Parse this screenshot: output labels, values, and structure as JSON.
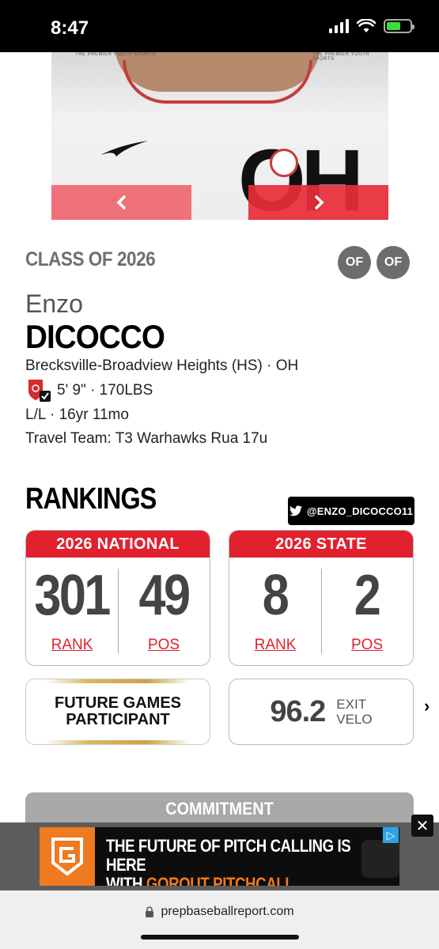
{
  "status_bar": {
    "time": "8:47"
  },
  "photo": {
    "prev_icon": "chevron-left-icon",
    "next_icon": "chevron-right-icon",
    "shirt_tagline": "THE PREMIER YOUTH SPORTS",
    "shirt_text": "OH"
  },
  "player": {
    "class_year": "CLASS OF 2026",
    "positions": [
      "OF",
      "OF"
    ],
    "first_name": "Enzo",
    "last_name": "DICOCCO",
    "school": "Brecksville-Broadview Heights (HS) · OH",
    "height_weight": "5' 9\" · 170LBS",
    "bats_throws_age": "L/L · 16yr 11mo",
    "travel_team": "Travel Team: T3 Warhawks Rua 17u"
  },
  "rankings": {
    "title": "RANKINGS",
    "twitter_handle": "@ENZO_DICOCCO11",
    "national": {
      "title": "2026 NATIONAL",
      "rank": "301",
      "rank_label": "RANK",
      "pos": "49",
      "pos_label": "POS"
    },
    "state": {
      "title": "2026 STATE",
      "rank": "8",
      "rank_label": "RANK",
      "pos": "2",
      "pos_label": "POS"
    },
    "future_games": "FUTURE GAMES PARTICIPANT",
    "exit_velo": {
      "value": "96.2",
      "label_line1": "EXIT",
      "label_line2": "VELO"
    }
  },
  "commitment": {
    "title": "COMMITMENT"
  },
  "ad": {
    "line1": "THE FUTURE OF PITCH CALLING IS HERE",
    "line2_prefix": "WITH ",
    "line2_highlight": "GOROUT PITCHCALL",
    "line2_suffix": ".",
    "logo_letter": "G",
    "brand_color": "#f07a1f"
  },
  "browser": {
    "url": "prepbaseballreport.com"
  },
  "colors": {
    "accent_red": "#e2212e",
    "badge_gray": "#6d6d6d"
  }
}
